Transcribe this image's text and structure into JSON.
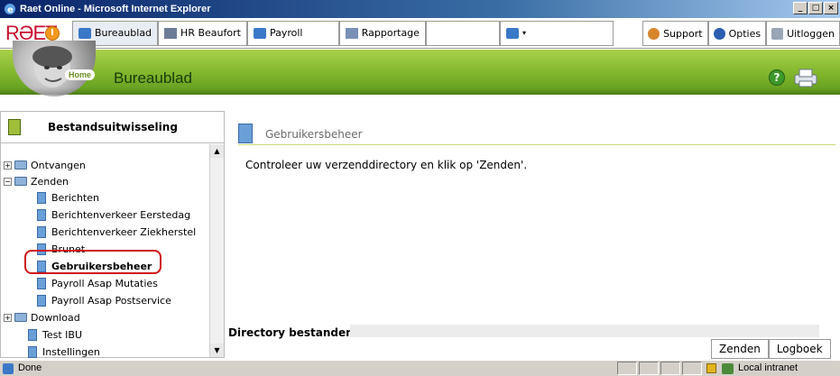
{
  "window": {
    "title": "Raet Online - Microsoft Internet Explorer",
    "minimize": "_",
    "maximize": "□",
    "close": "×"
  },
  "toolbar": {
    "logo": "RƏET",
    "tabs": [
      {
        "label": "Bureaublad",
        "icon": "book-icon"
      },
      {
        "label": "HR Beaufort",
        "icon": "hr-icon"
      },
      {
        "label": "Payroll",
        "icon": "book-icon"
      },
      {
        "label": "Rapportage",
        "icon": "report-icon"
      }
    ],
    "right_tabs": [
      {
        "label": "Support",
        "icon": "support-icon"
      },
      {
        "label": "Opties",
        "icon": "options-icon"
      },
      {
        "label": "Uitloggen",
        "icon": "logout-icon"
      }
    ]
  },
  "header": {
    "home_label": "Home",
    "title": "Bureaublad"
  },
  "sidebar": {
    "title": "Bestandsuitwisseling",
    "items": [
      {
        "label": "Ontvangen"
      },
      {
        "label": "Zenden"
      },
      {
        "label": "Berichten"
      },
      {
        "label": "Berichtenverkeer Eerstedag"
      },
      {
        "label": "Berichtenverkeer Ziekherstel"
      },
      {
        "label": "Brunet"
      },
      {
        "label": "Gebruikersbeheer"
      },
      {
        "label": "Payroll Asap Mutaties"
      },
      {
        "label": "Payroll Asap Postservice"
      },
      {
        "label": "Download"
      },
      {
        "label": "Test IBU"
      },
      {
        "label": "Instellingen"
      }
    ]
  },
  "main": {
    "title": "Gebruikersbeheer",
    "instruction": "Controleer uw verzenddirectory en klik op 'Zenden'.",
    "directory_label": "Directory bestanden:",
    "buttons": {
      "send": "Zenden",
      "log": "Logboek"
    }
  },
  "status": {
    "text": "Done",
    "zone": "Local intranet"
  },
  "colors": {
    "accent_green": "#7fb52b",
    "highlight_red": "#d01313",
    "title_blue": "#0a246a"
  }
}
